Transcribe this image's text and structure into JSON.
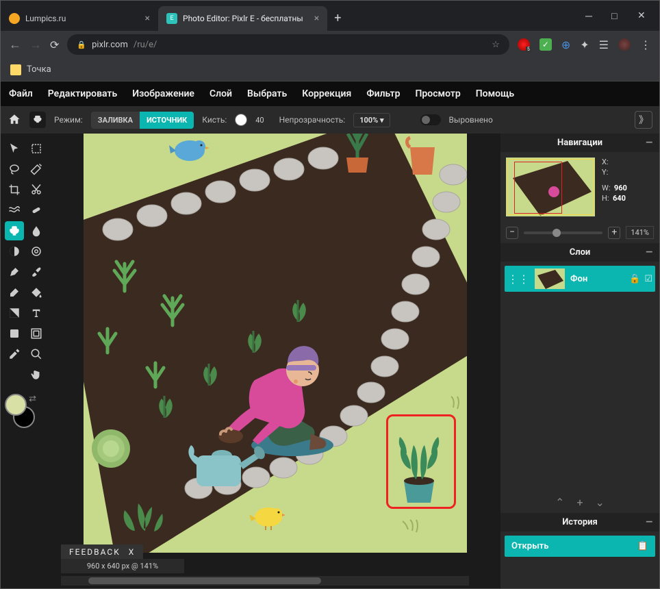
{
  "browser": {
    "tabs": [
      {
        "title": "Lumpics.ru",
        "favicon_color": "#f5a623",
        "active": false
      },
      {
        "title": "Photo Editor: Pixlr E - бесплатны",
        "favicon_color": "#2dc3bb",
        "active": true
      }
    ],
    "url_host": "pixlr.com",
    "url_path": "/ru/e/",
    "bookmarks": [
      {
        "label": "Точка"
      }
    ]
  },
  "menubar": [
    "Файл",
    "Редактировать",
    "Изображение",
    "Слой",
    "Выбрать",
    "Коррекция",
    "Фильтр",
    "Просмотр",
    "Помощь"
  ],
  "optbar": {
    "mode_label": "Режим:",
    "mode_fill": "ЗАЛИВКА",
    "mode_source": "ИСТОЧНИК",
    "brush_label": "Кисть:",
    "brush_size": "40",
    "opacity_label": "Непрозрачность:",
    "opacity_value": "100%",
    "aligned_label": "Выровнено"
  },
  "feedback": {
    "text": "FEEDBACK",
    "close": "X"
  },
  "status": "960 x 640 px @ 141%",
  "panels": {
    "navigation": {
      "title": "Навигации",
      "x_label": "X:",
      "y_label": "Y:",
      "w_label": "W:",
      "h_label": "H:",
      "w": "960",
      "h": "640",
      "zoom": "141%"
    },
    "layers": {
      "title": "Слои",
      "items": [
        {
          "name": "Фон"
        }
      ]
    },
    "history": {
      "title": "История",
      "items": [
        "Открыть"
      ]
    }
  }
}
